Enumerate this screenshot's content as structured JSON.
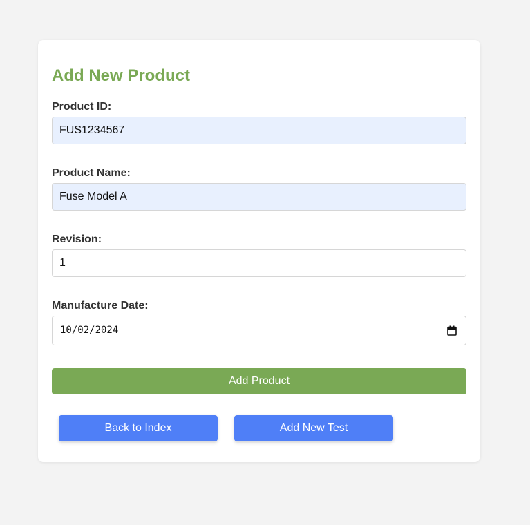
{
  "form": {
    "title": "Add New Product",
    "fields": [
      {
        "label": "Product ID:",
        "value": "FUS1234567"
      },
      {
        "label": "Product Name:",
        "value": "Fuse Model A"
      },
      {
        "label": "Revision:",
        "value": "1"
      },
      {
        "label": "Manufacture Date:",
        "value": "10/02/2024"
      }
    ],
    "submit_label": "Add Product"
  },
  "actions": {
    "back_label": "Back to Index",
    "add_test_label": "Add New Test"
  },
  "colors": {
    "accent_green": "#7aa955",
    "button_blue": "#4f7ff7",
    "autofill_bg": "#e8f0fe",
    "page_bg": "#f3f3f3"
  },
  "icons": {
    "date_picker": "calendar-icon"
  }
}
